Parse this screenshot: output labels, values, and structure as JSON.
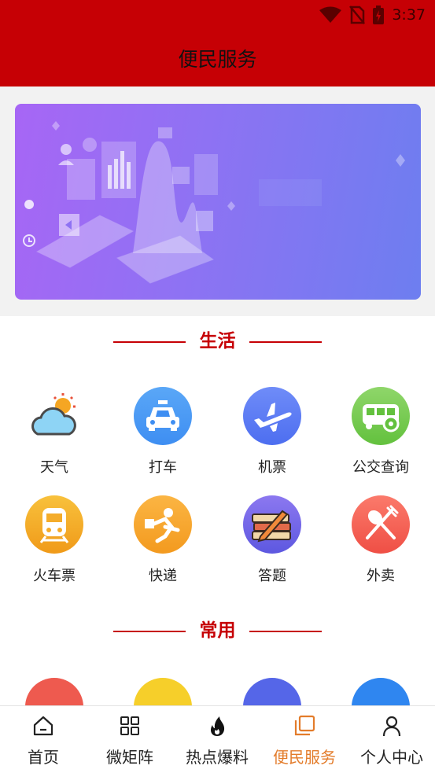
{
  "status_bar": {
    "time": "3:37"
  },
  "header": {
    "title": "便民服务"
  },
  "sections": [
    {
      "title": "生活",
      "items": [
        {
          "label": "天气",
          "icon": "weather-icon"
        },
        {
          "label": "打车",
          "icon": "taxi-icon"
        },
        {
          "label": "机票",
          "icon": "airplane-icon"
        },
        {
          "label": "公交查询",
          "icon": "bus-icon"
        },
        {
          "label": "火车票",
          "icon": "train-icon"
        },
        {
          "label": "快递",
          "icon": "courier-icon"
        },
        {
          "label": "答题",
          "icon": "quiz-books-icon"
        },
        {
          "label": "外卖",
          "icon": "food-delivery-icon"
        }
      ]
    },
    {
      "title": "常用"
    }
  ],
  "bottom_nav": {
    "active_index": 3,
    "items": [
      {
        "label": "首页",
        "icon": "home-icon"
      },
      {
        "label": "微矩阵",
        "icon": "grid-icon"
      },
      {
        "label": "热点爆料",
        "icon": "fire-icon"
      },
      {
        "label": "便民服务",
        "icon": "service-icon"
      },
      {
        "label": "个人中心",
        "icon": "user-icon"
      }
    ]
  },
  "colors": {
    "brand_red": "#c60005",
    "nav_active": "#e37c2b",
    "banner_start": "#a766f5",
    "banner_end": "#6d7ef0"
  }
}
